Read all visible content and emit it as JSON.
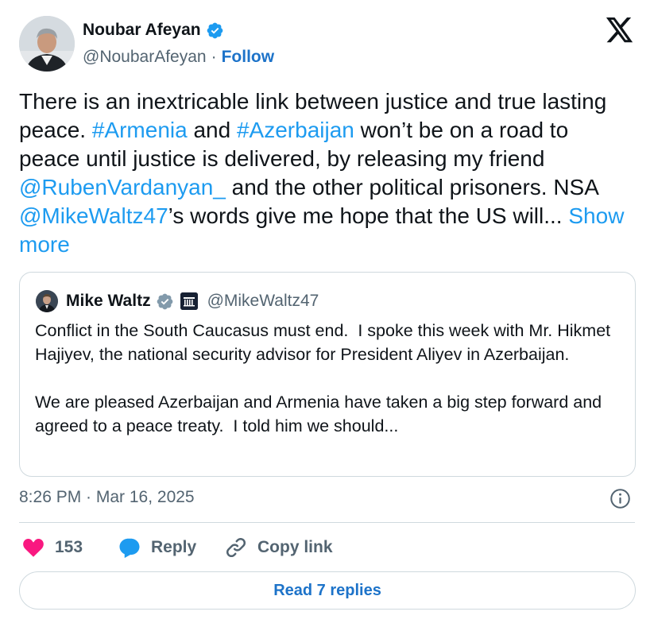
{
  "author": {
    "name": "Noubar Afeyan",
    "handle": "@NoubarAfeyan",
    "separator": "·",
    "follow_label": "Follow"
  },
  "tweet": {
    "segments": [
      {
        "text": "There is an inextricable link between justice and true lasting peace. ",
        "type": "text"
      },
      {
        "text": "#Armenia",
        "type": "link"
      },
      {
        "text": " and ",
        "type": "text"
      },
      {
        "text": "#Azerbaijan",
        "type": "link"
      },
      {
        "text": " won’t be on a road to peace until justice is delivered, by releasing my friend ",
        "type": "text"
      },
      {
        "text": "@RubenVardanyan_",
        "type": "link"
      },
      {
        "text": " and the other political prisoners. NSA ",
        "type": "text"
      },
      {
        "text": "@MikeWaltz47",
        "type": "link"
      },
      {
        "text": "’s words give me hope that the US will... ",
        "type": "text"
      }
    ],
    "show_more_label": "Show more"
  },
  "quote": {
    "name": "Mike Waltz",
    "handle": "@MikeWaltz47",
    "text": "Conflict in the South Caucasus must end.  I spoke this week with Mr. Hikmet Hajiyev, the national security advisor for President Aliyev in Azerbaijan.\n\nWe are pleased Azerbaijan and Armenia have taken a big step forward and agreed to a peace treaty.  I told him we should..."
  },
  "timestamp": "8:26 PM · Mar 16, 2025",
  "actions": {
    "like_count": "153",
    "reply_label": "Reply",
    "copy_label": "Copy link"
  },
  "read_replies_label": "Read 7 replies",
  "icons": {
    "brand": "x-logo-icon",
    "verified": "verified-badge-icon",
    "government": "government-affiliation-icon",
    "like": "heart-icon",
    "reply": "reply-bubble-icon",
    "copy": "link-icon",
    "info": "info-icon"
  },
  "colors": {
    "link": "#1d9bf0",
    "follow": "#1d73c9",
    "muted": "#536471",
    "verified": "#1d9bf0",
    "quote_verified": "#829aab",
    "heart": "#f91880",
    "border": "#cfd9de"
  }
}
